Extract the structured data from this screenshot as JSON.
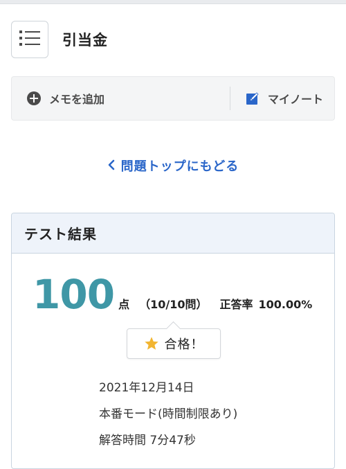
{
  "header": {
    "title": "引当金",
    "menu_icon": "list-menu-icon"
  },
  "toolbar": {
    "memo_label": "メモを追加",
    "memo_icon": "plus-circle-icon",
    "note_label": "マイノート",
    "note_icon": "edit-note-icon"
  },
  "back_link": {
    "label": "問題トップにもどる",
    "icon": "chevron-left-icon"
  },
  "result": {
    "title": "テスト結果",
    "score": "100",
    "score_unit": "点",
    "detail": "（10/10問）",
    "rate_label": "正答率",
    "rate": "100.00%",
    "badge_label": "合格！",
    "badge_icon": "star-icon",
    "date": "2021年12月14日",
    "mode": "本番モード(時間制限あり)",
    "time": "解答時間 7分47秒"
  },
  "colors": {
    "accent_blue": "#2a66c9",
    "score_teal": "#3f97a6",
    "star_gold": "#f2b531",
    "card_header_bg": "#eef3fa"
  }
}
